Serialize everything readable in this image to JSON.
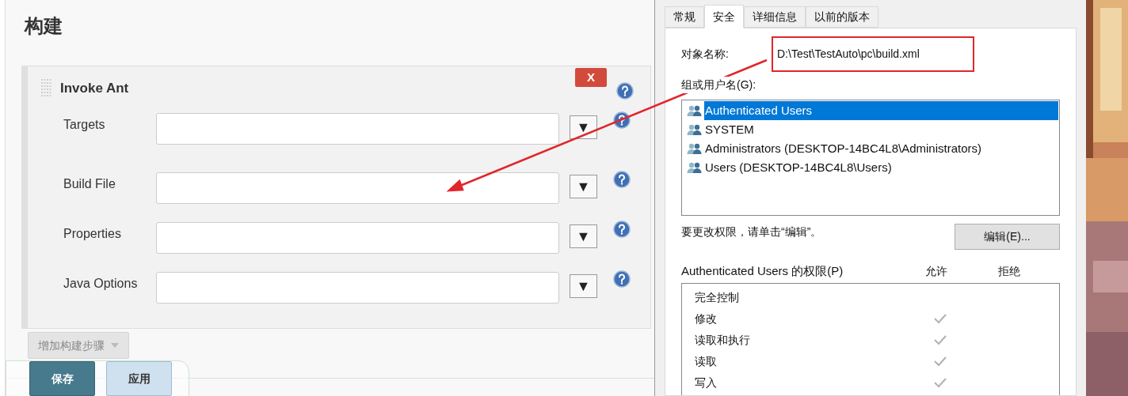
{
  "build_panel": {
    "title": "构建",
    "step": {
      "title": "Invoke Ant",
      "delete_button": "X",
      "fields": [
        {
          "label": "Targets",
          "dropdown": "▼"
        },
        {
          "label": "Build File",
          "dropdown": "▼"
        },
        {
          "label": "Properties",
          "dropdown": "▼"
        },
        {
          "label": "Java Options",
          "dropdown": "▼"
        }
      ]
    },
    "add_step_button": "增加构建步骤",
    "buttons": [
      {
        "label": "保存",
        "kind": "primary"
      },
      {
        "label": "应用",
        "kind": "secondary"
      }
    ]
  },
  "properties_dialog": {
    "tabs": [
      {
        "label": "常规",
        "selected": false
      },
      {
        "label": "安全",
        "selected": true
      },
      {
        "label": "详细信息",
        "selected": false
      },
      {
        "label": "以前的版本",
        "selected": false
      }
    ],
    "object_name_label": "对象名称:",
    "object_name": "D:\\Test\\TestAuto\\pc\\build.xml",
    "groups_label": "组或用户名(G):",
    "groups": [
      {
        "name": "Authenticated Users",
        "selected": true
      },
      {
        "name": "SYSTEM",
        "selected": false
      },
      {
        "name": "Administrators (DESKTOP-14BC4L8\\Administrators)",
        "selected": false
      },
      {
        "name": "Users (DESKTOP-14BC4L8\\Users)",
        "selected": false
      }
    ],
    "edit_hint": "要更改权限，请单击“编辑”。",
    "edit_button": "编辑(E)...",
    "permissions_label": "Authenticated Users 的权限(P)",
    "allow_header": "允许",
    "deny_header": "拒绝",
    "permissions": [
      {
        "name": "完全控制",
        "allow": false,
        "deny": false
      },
      {
        "name": "修改",
        "allow": true,
        "deny": false
      },
      {
        "name": "读取和执行",
        "allow": true,
        "deny": false
      },
      {
        "name": "读取",
        "allow": true,
        "deny": false
      },
      {
        "name": "写入",
        "allow": true,
        "deny": false
      }
    ]
  }
}
